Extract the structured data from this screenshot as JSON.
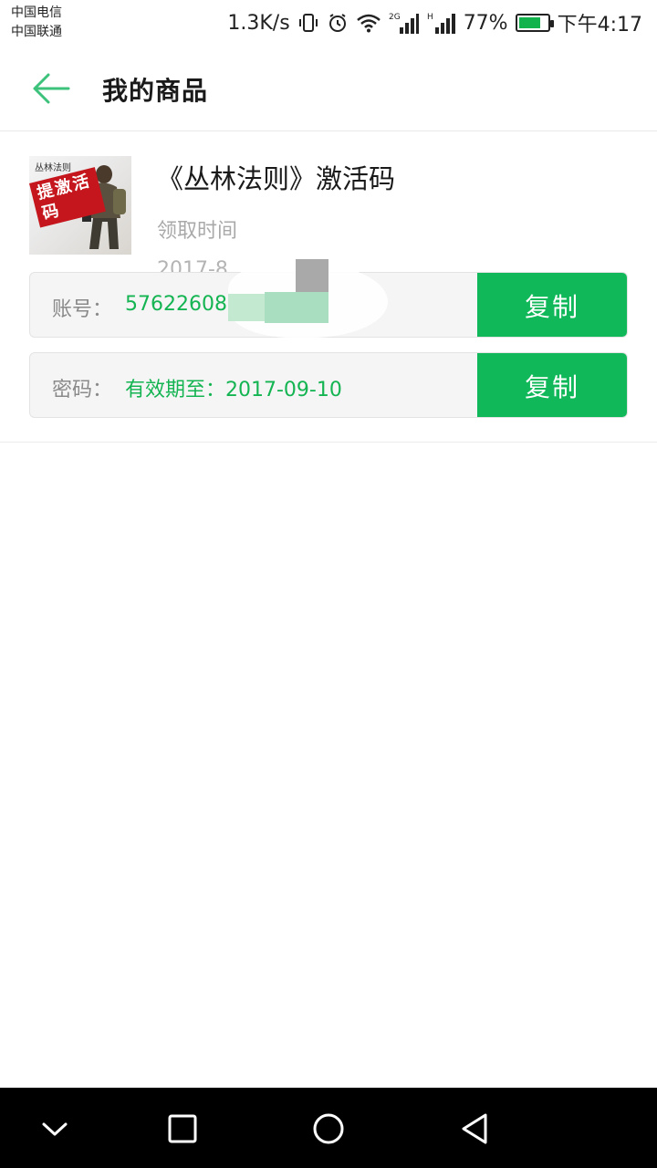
{
  "status_bar": {
    "carrier_1": "中国电信",
    "carrier_2": "中国联通",
    "net_speed": "1.3K/s",
    "battery_percent_text": "77%",
    "battery_level": 0.77,
    "time": "下午4:17",
    "icons": [
      "vibrate-icon",
      "alarm-icon",
      "wifi-icon",
      "signal-2g-icon",
      "signal-h-icon",
      "battery-charging-icon"
    ]
  },
  "header": {
    "title": "我的商品",
    "back_icon": "arrow-left-icon",
    "accent_color": "#3cc27a"
  },
  "product": {
    "title": "《丛林法则》激活码",
    "thumbnail_title": "丛林法则",
    "thumbnail_badge": "提激活码",
    "time_label": "领取时间",
    "time_value": "2017-8",
    "account": {
      "label": "账号：",
      "value": "57622608",
      "copy_label": "复制"
    },
    "password": {
      "label": "密码：",
      "value": "有效期至：2017-09-10",
      "copy_label": "复制"
    },
    "button_color": "#10b85a",
    "value_color": "#14b452"
  },
  "nav_bar": {
    "icons": [
      "chevron-down-icon",
      "recents-square-icon",
      "home-circle-icon",
      "back-triangle-icon"
    ]
  }
}
